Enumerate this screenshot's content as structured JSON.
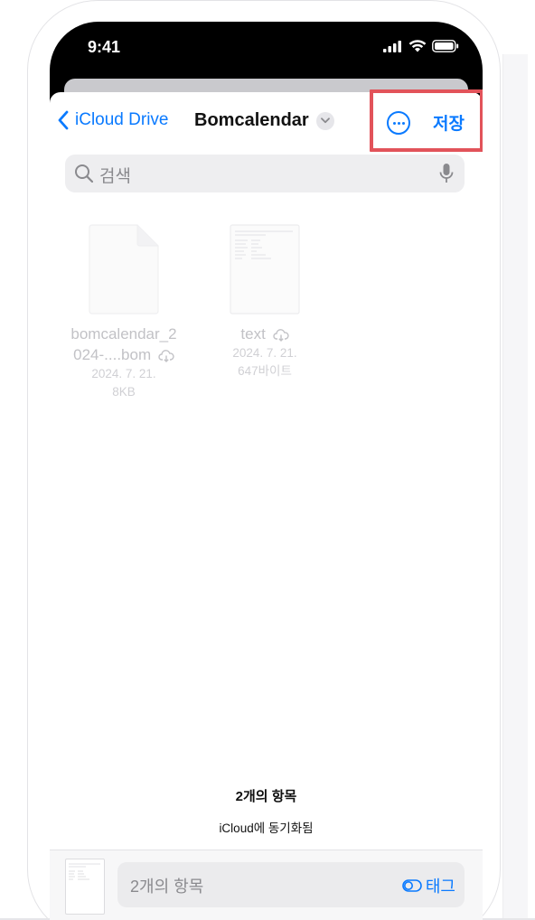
{
  "status": {
    "time": "9:41"
  },
  "nav": {
    "back_label": "iCloud Drive",
    "title": "Bomcalendar",
    "save_label": "저장"
  },
  "search": {
    "placeholder": "검색"
  },
  "files": [
    {
      "name_line1": "bomcalendar_2",
      "name_line2": "024-....bom",
      "date": "2024. 7. 21.",
      "size": "8KB",
      "cloud": true
    },
    {
      "name_line1": "text",
      "name_line2": "",
      "date": "2024. 7. 21.",
      "size": "647바이트",
      "cloud": true
    }
  ],
  "summary": {
    "count": "2개의 항목",
    "sync": "iCloud에 동기화됨"
  },
  "bottom": {
    "name_value": "2개의 항목",
    "tag_label": "태그"
  },
  "colors": {
    "accent": "#0a7aff",
    "highlight": "#e2535a"
  }
}
